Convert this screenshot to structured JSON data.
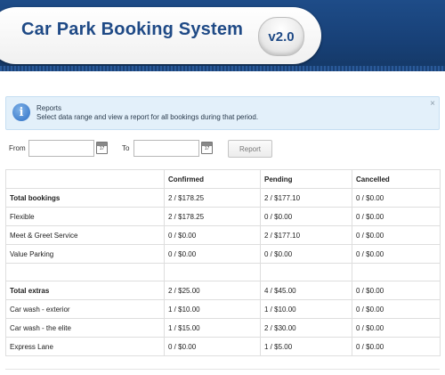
{
  "header": {
    "title": "Car Park Booking System",
    "version": "v2.0"
  },
  "info": {
    "title": "Reports",
    "text": "Select data range and view a report for all bookings during that period.",
    "close": "×"
  },
  "filters": {
    "from_label": "From",
    "to_label": "To",
    "from_value": "",
    "to_value": "",
    "calendar_glyph": "17",
    "report_button": "Report"
  },
  "table": {
    "headers": [
      "",
      "Confirmed",
      "Pending",
      "Cancelled"
    ],
    "rows": [
      {
        "label": "Total bookings",
        "bold": true,
        "cells": [
          "2 / $178.25",
          "2 / $177.10",
          "0 / $0.00"
        ]
      },
      {
        "label": "Flexible",
        "bold": false,
        "cells": [
          "2 / $178.25",
          "0 / $0.00",
          "0 / $0.00"
        ]
      },
      {
        "label": "Meet & Greet Service",
        "bold": false,
        "cells": [
          "0 / $0.00",
          "2 / $177.10",
          "0 / $0.00"
        ]
      },
      {
        "label": "Value Parking",
        "bold": false,
        "cells": [
          "0 / $0.00",
          "0 / $0.00",
          "0 / $0.00"
        ]
      },
      {
        "label": "",
        "bold": false,
        "cells": [
          "",
          "",
          ""
        ]
      },
      {
        "label": "Total extras",
        "bold": true,
        "cells": [
          "2 / $25.00",
          "4 / $45.00",
          "0 / $0.00"
        ]
      },
      {
        "label": "Car wash - exterior",
        "bold": false,
        "cells": [
          "1 / $10.00",
          "1 / $10.00",
          "0 / $0.00"
        ]
      },
      {
        "label": "Car wash - the elite",
        "bold": false,
        "cells": [
          "1 / $15.00",
          "2 / $30.00",
          "0 / $0.00"
        ]
      },
      {
        "label": "Express Lane",
        "bold": false,
        "cells": [
          "0 / $0.00",
          "1 / $5.00",
          "0 / $0.00"
        ]
      }
    ]
  },
  "colors": {
    "header_blue": "#1e4c88",
    "title_text": "#1f4a86",
    "info_bg": "#e3f0fa",
    "info_icon": "#2e6fc4"
  }
}
